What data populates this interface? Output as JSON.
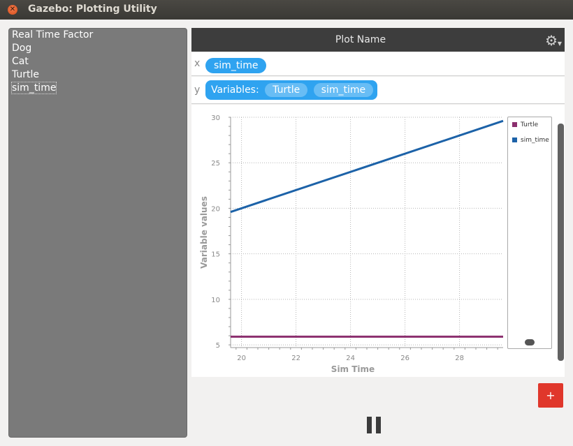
{
  "window": {
    "title": "Gazebo: Plotting Utility",
    "close_icon": "close-icon"
  },
  "topics": [
    {
      "label": "Real Time Factor",
      "selected": false
    },
    {
      "label": "Dog",
      "selected": false
    },
    {
      "label": "Cat",
      "selected": false
    },
    {
      "label": "Turtle",
      "selected": false
    },
    {
      "label": "sim_time",
      "selected": true
    }
  ],
  "plot": {
    "name": "Plot Name",
    "settings_icon": "gear-icon",
    "x_axis": {
      "letter": "x",
      "variable": "sim_time"
    },
    "y_axis": {
      "letter": "y",
      "variables_label": "Variables:",
      "variables": [
        "Turtle",
        "sim_time"
      ]
    }
  },
  "chart_data": {
    "type": "line",
    "xlabel": "Sim Time",
    "ylabel": "Variable values",
    "xlim": [
      19.6,
      29.6
    ],
    "ylim": [
      4.7,
      30
    ],
    "xticks": [
      20,
      22,
      24,
      26,
      28
    ],
    "yticks": [
      5,
      10,
      15,
      20,
      25,
      30
    ],
    "grid": true,
    "legend_position": "right",
    "series": [
      {
        "name": "Turtle",
        "color": "#8b2f6e",
        "x": [
          19.6,
          29.6
        ],
        "y": [
          5.9,
          5.9
        ]
      },
      {
        "name": "sim_time",
        "color": "#1c62a8",
        "x": [
          19.6,
          29.6
        ],
        "y": [
          19.6,
          29.6
        ]
      }
    ]
  },
  "controls": {
    "add_label": "+",
    "pause_icon": "pause-icon"
  },
  "colors": {
    "accent": "#2fa3f0",
    "add_button": "#e0372b",
    "header": "#3d3d3d"
  }
}
